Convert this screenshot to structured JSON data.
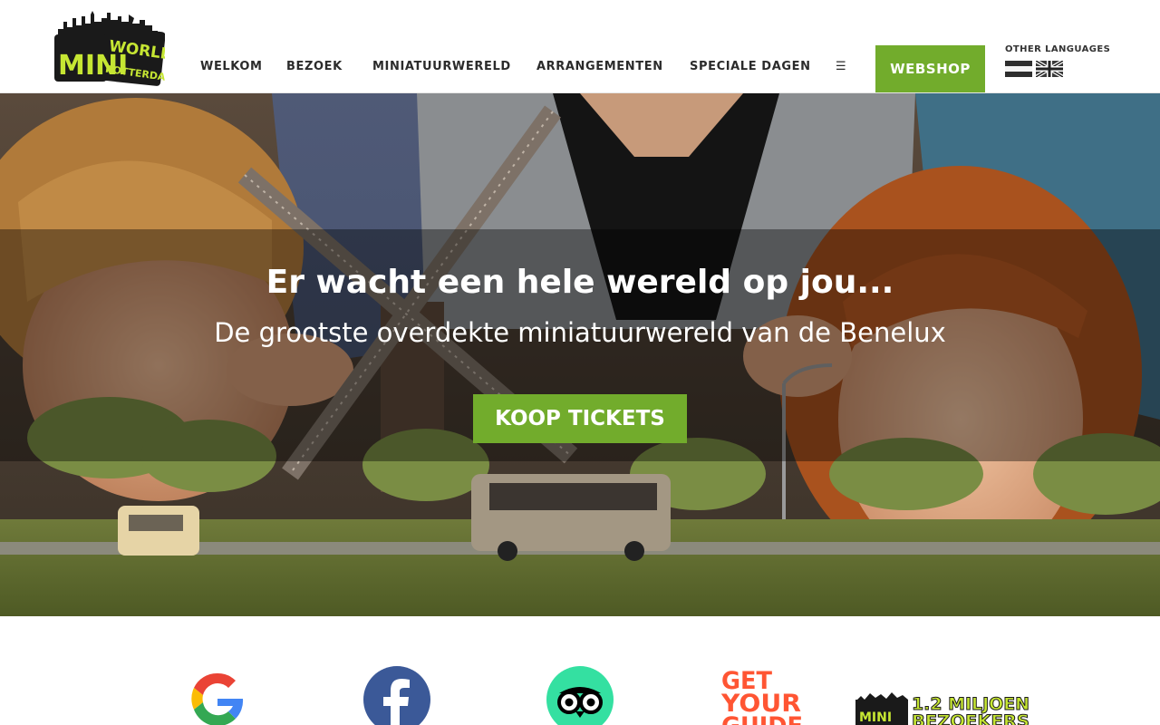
{
  "header": {
    "logo": {
      "line1": "MINI",
      "line2": "WORLD",
      "line3": "ROTTERDAM",
      "colors": {
        "green": "#c6e633",
        "dark": "#1a1a1a"
      }
    },
    "nav": [
      {
        "label": "WELKOM"
      },
      {
        "label": "BEZOEK"
      },
      {
        "label": "MINIATUURWERELD"
      },
      {
        "label": "ARRANGEMENTEN"
      },
      {
        "label": "SPECIALE DAGEN"
      },
      {
        "label": "☰"
      }
    ],
    "webshop_label": "WEBSHOP",
    "languages_label": "OTHER LANGUAGES",
    "flags": [
      {
        "icon": "dutch-flag-icon"
      },
      {
        "icon": "uk-flag-icon"
      }
    ]
  },
  "hero": {
    "title": "Er wacht een hele wereld op jou...",
    "subtitle": "De grootste overdekte miniatuurwereld van de Benelux",
    "cta_label": "KOOP TICKETS"
  },
  "reviews": {
    "items": [
      {
        "icon": "google-icon"
      },
      {
        "icon": "facebook-icon"
      },
      {
        "icon": "tripadvisor-icon"
      },
      {
        "icon": "getyourguide-logo",
        "text_lines": [
          "GET",
          "YOUR",
          "GUIDE"
        ]
      },
      {
        "icon": "visitors-badge",
        "text_lines": [
          "1.2 MILJOEN",
          "BEZOEKERS"
        ]
      }
    ]
  },
  "colors": {
    "accent_green": "#72ac2c",
    "nav_text": "#2b2b2b"
  }
}
